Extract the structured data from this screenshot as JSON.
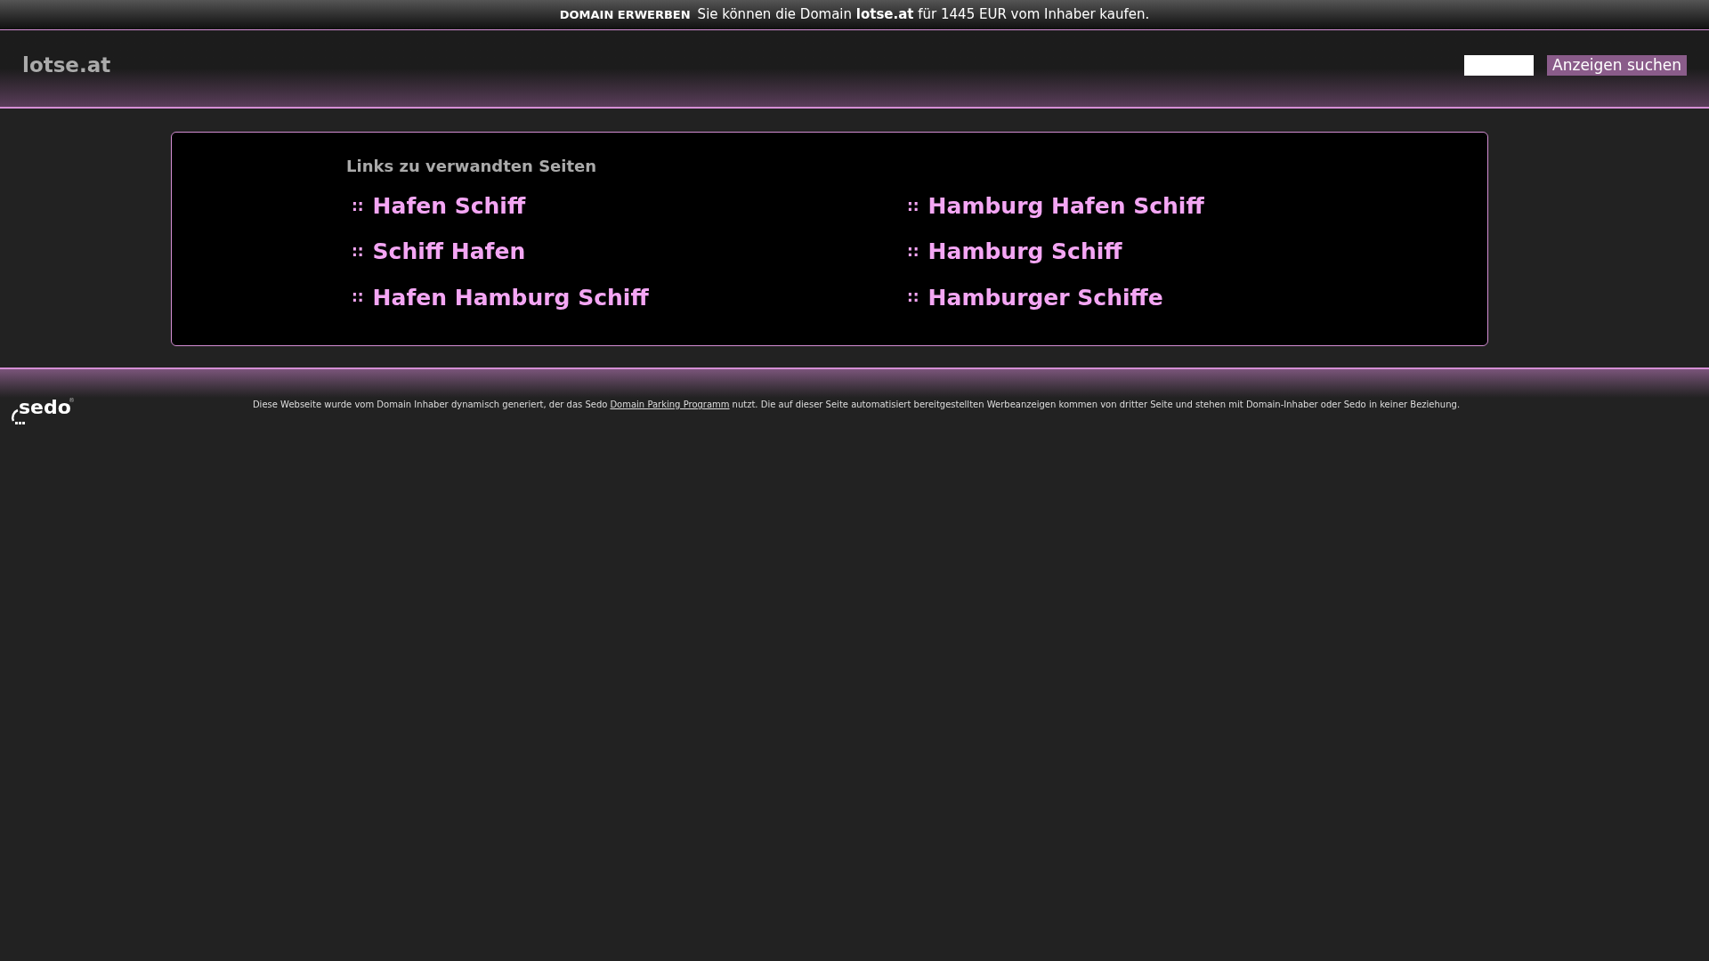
{
  "top_bar": {
    "label": "DOMAIN ERWERBEN",
    "message": "Sie können die Domain **lotse.at** für 1445 EUR vom Inhaber kaufen."
  },
  "header": {
    "site_name": "lotse.at",
    "search_button": "Anzeigen suchen"
  },
  "links_box": {
    "title": "Links zu verwandten Seiten",
    "links": [
      {
        "bullet": "::",
        "label": "Hafen Schiff"
      },
      {
        "bullet": "::",
        "label": "Hamburg Hafen Schiff"
      },
      {
        "bullet": "::",
        "label": "Schiff Hafen"
      },
      {
        "bullet": "::",
        "label": "Hamburg Schiff"
      },
      {
        "bullet": "::",
        "label": "Hafen Hamburg Schiff"
      },
      {
        "bullet": "::",
        "label": "Hamburger Schiffe"
      }
    ]
  },
  "footer": {
    "logo": "sedo",
    "logo_mark": "®",
    "disclaimer_before": "Diese Webseite wurde vom Domain Inhaber dynamisch generiert, der das Sedo",
    "disclaimer_link": "Domain Parking Programm",
    "disclaimer_after": "nutzt. Die auf dieser Seite automatisiert bereitgestellten Werbeanzeigen kommen von dritter Seite und stehen mit Domain-Inhaber oder Sedo in keiner Beziehung."
  }
}
